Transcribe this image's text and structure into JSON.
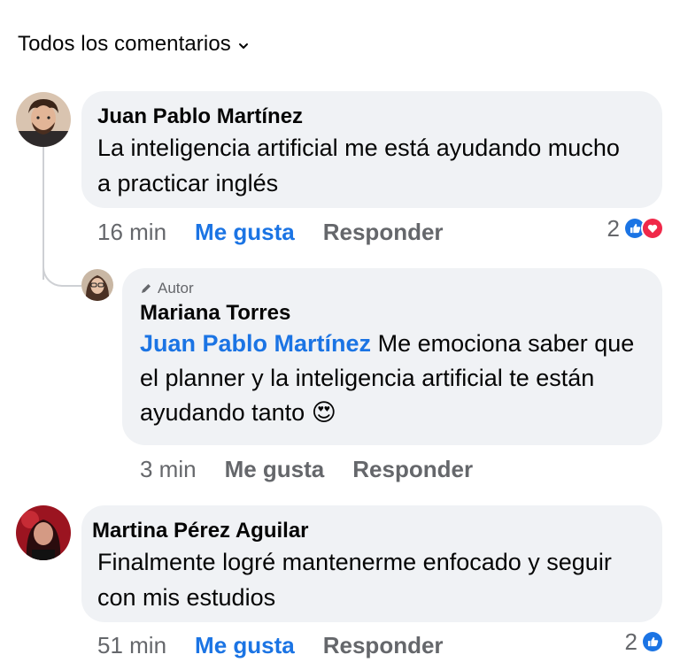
{
  "header": {
    "title": "Todos los comentarios",
    "icon": "chevron-down-icon"
  },
  "comments": [
    {
      "author": "Juan Pablo Martínez",
      "text": "La inteligencia artificial me está ayudando mucho a practicar inglés",
      "time": "16 min",
      "like_label": "Me gusta",
      "liked": true,
      "reply_label": "Responder",
      "reaction_count": "2",
      "reactions": [
        "like-icon",
        "love-icon"
      ]
    },
    {
      "badge": "Autor",
      "badge_icon": "pencil-icon",
      "author": "Mariana Torres",
      "mention": "Juan Pablo Martínez",
      "text": "Me emociona saber que el planner y la inteligencia artificial te están ayudando tanto",
      "emoji": "😍",
      "time": "3 min",
      "like_label": "Me gusta",
      "liked": false,
      "reply_label": "Responder"
    },
    {
      "author": "Martina Pérez Aguilar",
      "text": "Finalmente logré mantenerme enfocado y seguir con mis estudios",
      "time": "51 min",
      "like_label": "Me gusta",
      "liked": true,
      "reply_label": "Responder",
      "reaction_count": "2",
      "reactions": [
        "like-icon"
      ]
    }
  ],
  "colors": {
    "accent": "#1b74e4",
    "bubble": "#f0f2f5",
    "muted": "#65676b",
    "love": "#f02849"
  }
}
